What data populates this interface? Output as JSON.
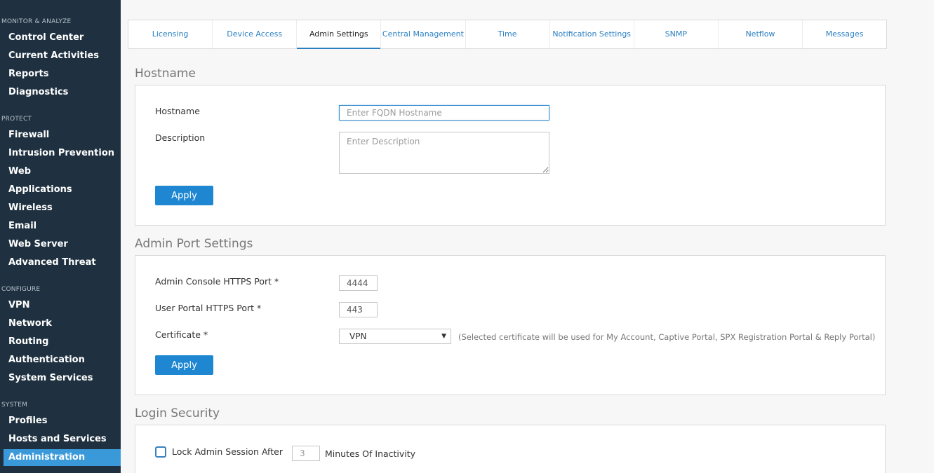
{
  "sidebar": {
    "sections": [
      {
        "title": "MONITOR & ANALYZE",
        "items": [
          "Control Center",
          "Current Activities",
          "Reports",
          "Diagnostics"
        ]
      },
      {
        "title": "PROTECT",
        "items": [
          "Firewall",
          "Intrusion Prevention",
          "Web",
          "Applications",
          "Wireless",
          "Email",
          "Web Server",
          "Advanced Threat"
        ]
      },
      {
        "title": "CONFIGURE",
        "items": [
          "VPN",
          "Network",
          "Routing",
          "Authentication",
          "System Services"
        ]
      },
      {
        "title": "SYSTEM",
        "items": [
          "Profiles",
          "Hosts and Services",
          "Administration"
        ]
      }
    ],
    "active_item": "Administration"
  },
  "tabs": [
    "Licensing",
    "Device Access",
    "Admin Settings",
    "Central Management",
    "Time",
    "Notification Settings",
    "SNMP",
    "Netflow",
    "Messages"
  ],
  "active_tab": "Admin Settings",
  "hostname_section": {
    "title": "Hostname",
    "hostname_label": "Hostname",
    "hostname_placeholder": "Enter FQDN Hostname",
    "description_label": "Description",
    "description_placeholder": "Enter Description",
    "apply_label": "Apply"
  },
  "admin_port_section": {
    "title": "Admin Port Settings",
    "https_port_label": "Admin Console HTTPS Port *",
    "https_port_value": "4444",
    "user_portal_label": "User Portal HTTPS Port *",
    "user_portal_value": "443",
    "certificate_label": "Certificate *",
    "certificate_value": "VPN",
    "certificate_note": "(Selected certificate will be used for My Account, Captive Portal, SPX Registration Portal & Reply Portal)",
    "apply_label": "Apply"
  },
  "login_security": {
    "title": "Login Security",
    "lock_label": "Lock Admin Session After",
    "lock_minutes": "3",
    "lock_suffix": "Minutes Of Inactivity"
  }
}
